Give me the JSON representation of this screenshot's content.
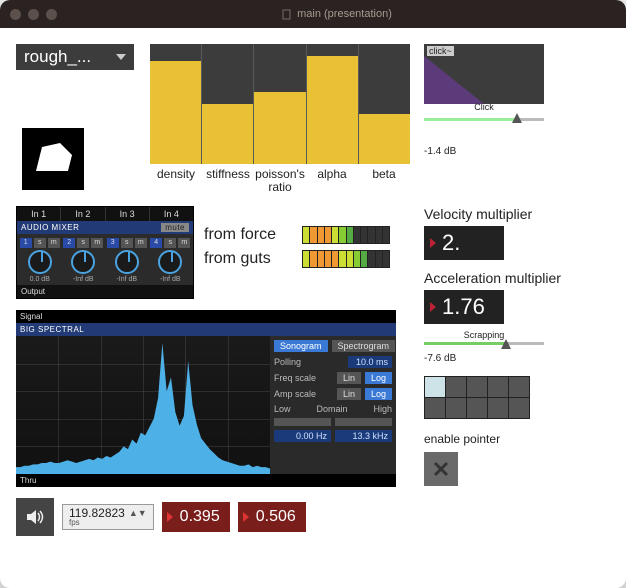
{
  "window": {
    "title": "main (presentation)"
  },
  "preset": {
    "label": "rough_..."
  },
  "chart_data": {
    "type": "bar",
    "categories": [
      "density",
      "stiffness",
      "poisson's ratio",
      "alpha",
      "beta"
    ],
    "values": [
      0.86,
      0.5,
      0.6,
      0.9,
      0.42
    ],
    "ylim": [
      0,
      1
    ]
  },
  "click": {
    "module": "click~",
    "label": "Click",
    "value_db": "-1.4 dB",
    "pos": 0.8
  },
  "mixer": {
    "tabs": [
      "In 1",
      "In 2",
      "In 3",
      "In 4"
    ],
    "title": "AUDIO MIXER",
    "mute": "mute",
    "channels": [
      {
        "num": "1",
        "db": "0.0 dB"
      },
      {
        "num": "2",
        "db": "-Inf dB"
      },
      {
        "num": "3",
        "db": "-Inf dB"
      },
      {
        "num": "4",
        "db": "-Inf dB"
      }
    ],
    "solo_btn": "s",
    "mute_btn": "m",
    "output": "Output"
  },
  "meters": {
    "rows": [
      {
        "label": "from force",
        "levels": [
          3,
          4,
          4,
          4,
          3,
          2,
          1,
          0,
          0,
          0,
          0,
          0
        ]
      },
      {
        "label": "from guts",
        "levels": [
          3,
          4,
          4,
          4,
          4,
          3,
          3,
          2,
          1,
          0,
          0,
          0
        ]
      }
    ],
    "palette": [
      "#333",
      "#5a4",
      "#8c3",
      "#cd3",
      "#e93"
    ]
  },
  "velocity": {
    "label": "Velocity multiplier",
    "value": "2."
  },
  "acceleration": {
    "label": "Acceleration multiplier",
    "value": "1.76"
  },
  "scrapping": {
    "label": "Scrapping",
    "value_db": "-7.6 dB",
    "pos": 0.7
  },
  "grid_buttons": {
    "rows": 2,
    "cols": 5,
    "lit_index": 0
  },
  "enable_pointer": {
    "label": "enable pointer"
  },
  "spectral": {
    "signal": "Signal",
    "title": "BIG SPECTRAL",
    "thru": "Thru",
    "tab_sonogram": "Sonogram",
    "tab_spectrogram": "Spectrogram",
    "polling_label": "Polling",
    "polling_value": "10.0 ms",
    "freq_label": "Freq scale",
    "lin": "Lin",
    "log": "Log",
    "amp_label": "Amp scale",
    "domain_label": "Domain",
    "low": "Low",
    "high": "High",
    "fmin": "0.00 Hz",
    "fmax": "13.3 kHz",
    "spectrum": [
      0.05,
      0.05,
      0.06,
      0.06,
      0.07,
      0.07,
      0.08,
      0.08,
      0.09,
      0.08,
      0.08,
      0.09,
      0.1,
      0.09,
      0.08,
      0.09,
      0.1,
      0.11,
      0.1,
      0.12,
      0.11,
      0.13,
      0.12,
      0.14,
      0.16,
      0.2,
      0.18,
      0.25,
      0.22,
      0.3,
      0.28,
      0.34,
      0.4,
      0.55,
      0.95,
      0.6,
      0.7,
      0.45,
      0.35,
      0.42,
      0.82,
      0.5,
      0.36,
      0.26,
      0.22,
      0.18,
      0.15,
      0.12,
      0.1,
      0.09,
      0.08,
      0.07,
      0.06,
      0.06,
      0.07,
      0.05,
      0.06,
      0.05,
      0.05,
      0.04
    ]
  },
  "bottom": {
    "fps": "119.82823",
    "fps_unit": "fps",
    "val1": "0.395",
    "val2": "0.506"
  }
}
